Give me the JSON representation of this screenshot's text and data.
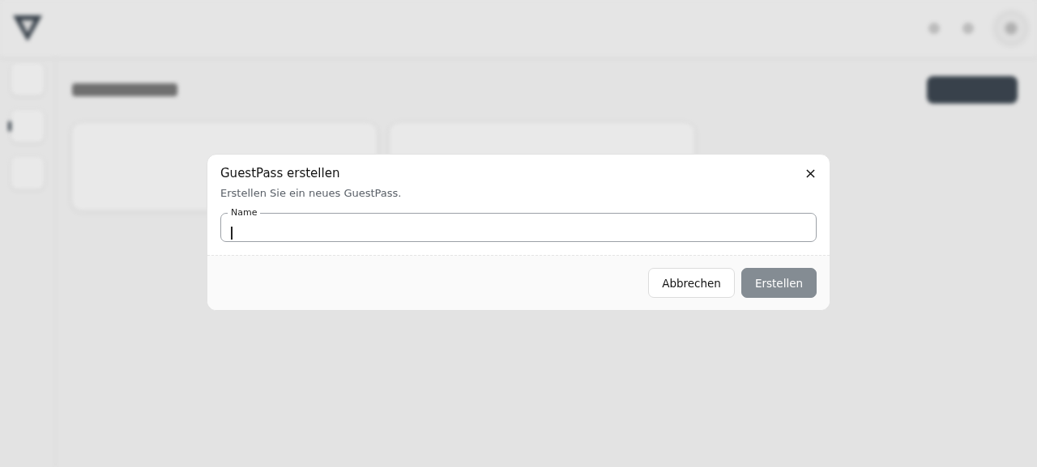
{
  "dialog": {
    "title": "GuestPass erstellen",
    "description": "Erstellen Sie ein neues GuestPass.",
    "field": {
      "label": "Name",
      "focused": true
    },
    "buttons": [
      {
        "label": "Abbrechen",
        "kind": "secondary",
        "disabled": false
      },
      {
        "label": "Erstellen",
        "kind": "primary",
        "disabled": true
      }
    ]
  }
}
